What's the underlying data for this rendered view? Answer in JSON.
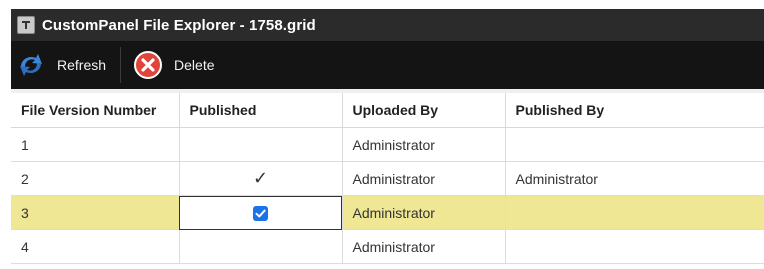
{
  "window": {
    "title": "CustomPanel File Explorer - 1758.grid"
  },
  "toolbar": {
    "refresh_label": "Refresh",
    "delete_label": "Delete"
  },
  "grid": {
    "columns": [
      "File Version Number",
      "Published",
      "Uploaded By",
      "Published By"
    ],
    "rows": [
      {
        "version": "1",
        "published": "",
        "uploaded_by": "Administrator",
        "published_by": ""
      },
      {
        "version": "2",
        "published": "✓",
        "uploaded_by": "Administrator",
        "published_by": "Administrator"
      },
      {
        "version": "3",
        "published": "checkbox-checked",
        "uploaded_by": "Administrator",
        "published_by": ""
      },
      {
        "version": "4",
        "published": "",
        "uploaded_by": "Administrator",
        "published_by": ""
      }
    ],
    "selected_row": 3
  },
  "colors": {
    "titlebar": "#2b2b2b",
    "toolbar": "#141414",
    "selected_row": "#efe793",
    "checkbox": "#1a73e8",
    "delete_icon": "#e0443a"
  },
  "icons": {
    "title": "app-icon",
    "refresh": "refresh-arrows-icon",
    "delete": "delete-x-circle-icon"
  }
}
